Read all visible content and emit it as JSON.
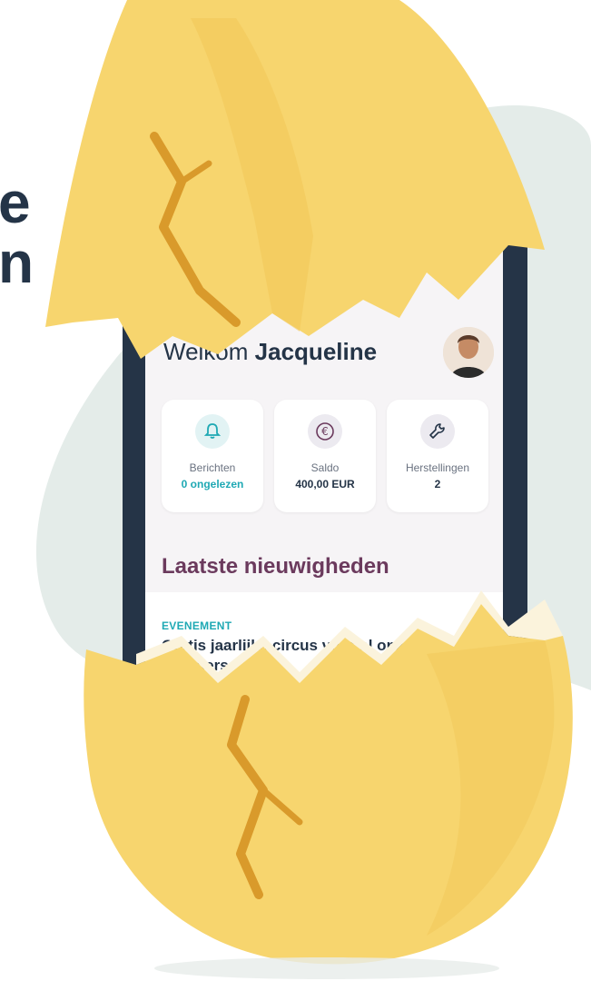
{
  "headline": {
    "line1": "e",
    "line2": "n"
  },
  "app": {
    "welcome_prefix": "Welkom",
    "user_name": "Jacqueline",
    "cards": [
      {
        "icon": "bell-icon",
        "label": "Berichten",
        "value": "0 ongelezen",
        "value_color": "#1fa9b4"
      },
      {
        "icon": "euro-icon",
        "label": "Saldo",
        "value": "400,00 EUR",
        "value_color": "#243447"
      },
      {
        "icon": "wrench-icon",
        "label": "Herstellingen",
        "value": "2",
        "value_color": "#243447"
      }
    ],
    "section_title": "Laatste nieuwigheden",
    "news": [
      {
        "tag": "EVENEMENT",
        "title": "Gratis jaarlijks circus voor al onze huurders"
      }
    ]
  },
  "colors": {
    "accent_teal": "#1fa9b4",
    "section_title": "#6b3a5d",
    "phone_frame": "#253447",
    "egg_shell": "#f7d56e",
    "egg_crack": "#d99a2b",
    "background_blob": "#e4ece9"
  }
}
